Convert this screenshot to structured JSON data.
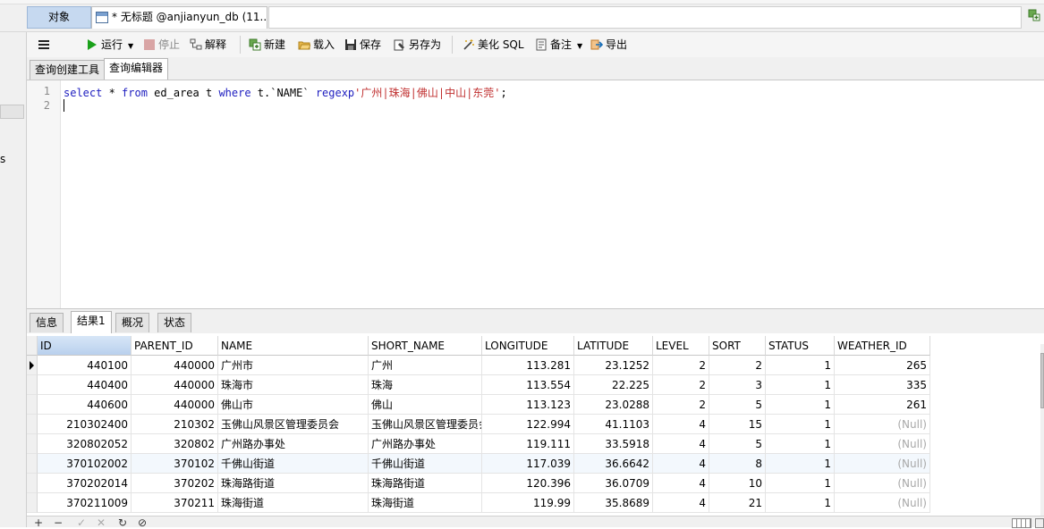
{
  "tabs": {
    "objects": "对象",
    "query": "* 无标题 @anjianyun_db (11..."
  },
  "toolbar": {
    "run": "运行",
    "stop": "停止",
    "explain": "解释",
    "new": "新建",
    "load": "载入",
    "save": "保存",
    "save_as": "另存为",
    "beautify": "美化 SQL",
    "memo": "备注",
    "export": "导出"
  },
  "subtabs": {
    "builder": "查询创建工具",
    "editor": "查询编辑器"
  },
  "editor": {
    "line_numbers": [
      "1",
      "2"
    ],
    "sql": {
      "kw_select": "select",
      "star": " * ",
      "kw_from": "from",
      "table": " ed_area t ",
      "kw_where": "where",
      "field": " t.`NAME` ",
      "kw_regexp": "regexp",
      "literal": "'广州|珠海|佛山|中山|东莞'",
      "end": ";"
    }
  },
  "left_edge_text": "s",
  "result_tabs": [
    "信息",
    "结果1",
    "概况",
    "状态"
  ],
  "grid": {
    "columns": [
      "ID",
      "PARENT_ID",
      "NAME",
      "SHORT_NAME",
      "LONGITUDE",
      "LATITUDE",
      "LEVEL",
      "SORT",
      "STATUS",
      "WEATHER_ID"
    ],
    "rows": [
      [
        "440100",
        "440000",
        "广州市",
        "广州",
        "113.281",
        "23.1252",
        "2",
        "2",
        "1",
        "265"
      ],
      [
        "440400",
        "440000",
        "珠海市",
        "珠海",
        "113.554",
        "22.225",
        "2",
        "3",
        "1",
        "335"
      ],
      [
        "440600",
        "440000",
        "佛山市",
        "佛山",
        "113.123",
        "23.0288",
        "2",
        "5",
        "1",
        "261"
      ],
      [
        "210302400",
        "210302",
        "玉佛山风景区管理委员会",
        "玉佛山风景区管理委员会",
        "122.994",
        "41.1103",
        "4",
        "15",
        "1",
        "(Null)"
      ],
      [
        "320802052",
        "320802",
        "广州路办事处",
        "广州路办事处",
        "119.111",
        "33.5918",
        "4",
        "5",
        "1",
        "(Null)"
      ],
      [
        "370102002",
        "370102",
        "千佛山街道",
        "千佛山街道",
        "117.039",
        "36.6642",
        "4",
        "8",
        "1",
        "(Null)"
      ],
      [
        "370202014",
        "370202",
        "珠海路街道",
        "珠海路街道",
        "120.396",
        "36.0709",
        "4",
        "10",
        "1",
        "(Null)"
      ],
      [
        "370211009",
        "370211",
        "珠海街道",
        "珠海街道",
        "119.99",
        "35.8689",
        "4",
        "21",
        "1",
        "(Null)"
      ]
    ],
    "selected_row": 0,
    "highlighted_row": 5
  },
  "bottom": {
    "add": "+",
    "remove": "−",
    "apply": "✓",
    "cancel": "✕",
    "refresh": "↻",
    "stop": "⊘"
  }
}
